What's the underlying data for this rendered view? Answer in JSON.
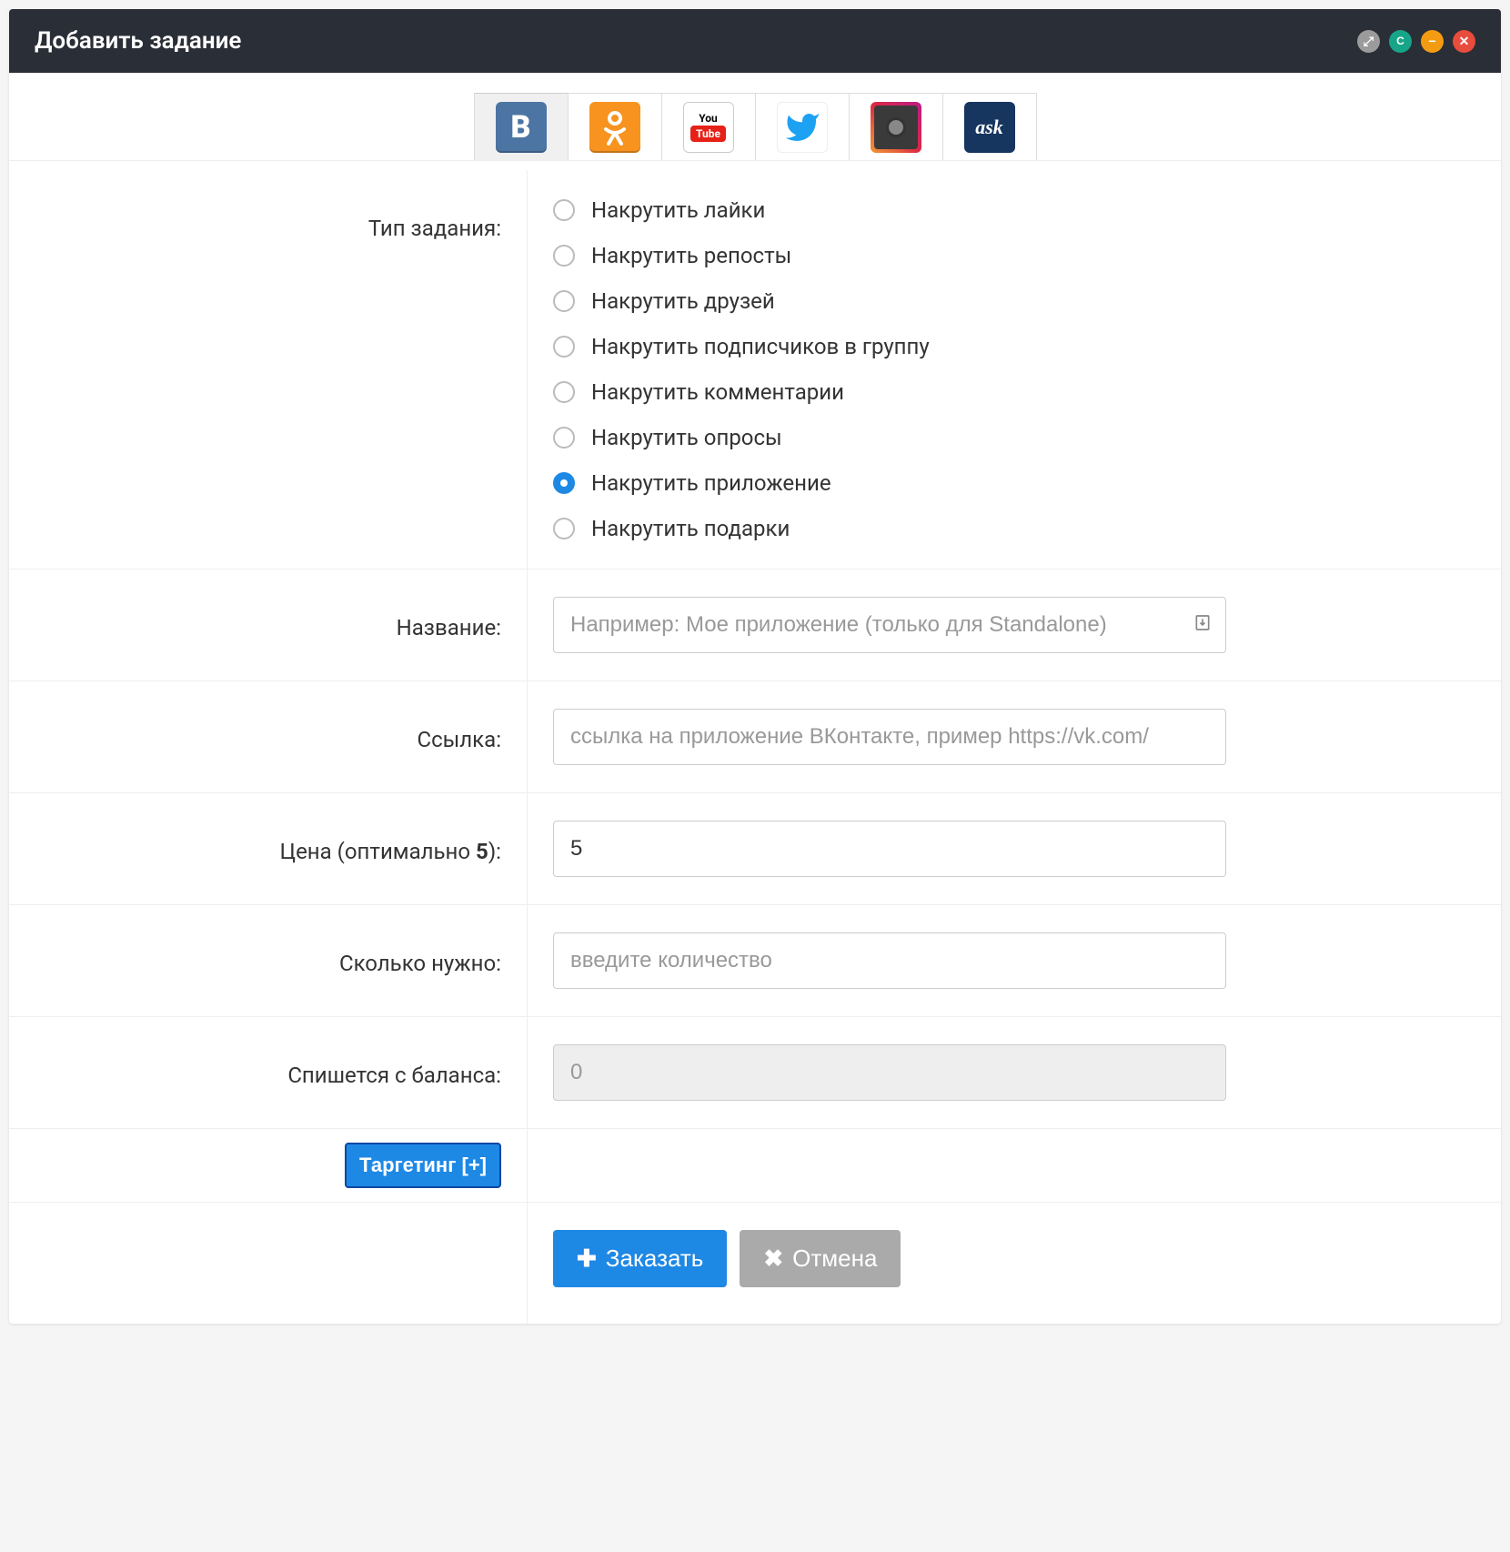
{
  "header": {
    "title": "Добавить задание"
  },
  "social_tabs": [
    {
      "name": "vk",
      "label": "В",
      "active": true
    },
    {
      "name": "ok",
      "label": "✿",
      "active": false
    },
    {
      "name": "youtube",
      "label": "YouTube",
      "active": false
    },
    {
      "name": "twitter",
      "label": "🐦",
      "active": false
    },
    {
      "name": "instagram",
      "label": "",
      "active": false
    },
    {
      "name": "ask",
      "label": "ask",
      "active": false
    }
  ],
  "form": {
    "task_type": {
      "label": "Тип задания:",
      "options": [
        "Накрутить лайки",
        "Накрутить репосты",
        "Накрутить друзей",
        "Накрутить подписчиков в группу",
        "Накрутить комментарии",
        "Накрутить опросы",
        "Накрутить приложение",
        "Накрутить подарки"
      ],
      "selected_index": 6
    },
    "name": {
      "label": "Название:",
      "placeholder": "Например: Мое приложение (только для Standalone)",
      "value": ""
    },
    "link": {
      "label": "Ссылка:",
      "placeholder": "ссылка на приложение ВКонтакте, пример https://vk.com/",
      "value": ""
    },
    "price": {
      "label_prefix": "Цена (оптимально ",
      "label_bold": "5",
      "label_suffix": "):",
      "value": "5"
    },
    "quantity": {
      "label": "Сколько нужно:",
      "placeholder": "введите количество",
      "value": ""
    },
    "balance": {
      "label": "Спишется с баланса:",
      "value": "0"
    },
    "targeting_button": "Таргетинг [+]"
  },
  "actions": {
    "order": "Заказать",
    "cancel": "Отмена"
  }
}
